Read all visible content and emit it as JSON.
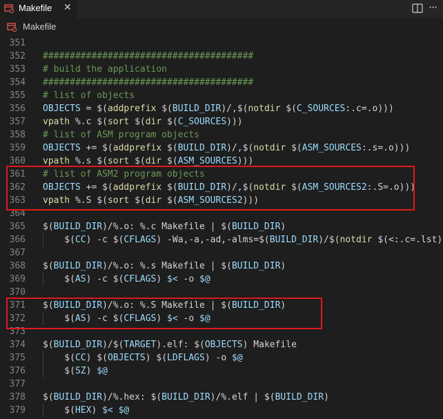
{
  "tab": {
    "label": "Makefile",
    "close": "✕"
  },
  "breadcrumb": {
    "label": "Makefile"
  },
  "header_actions": {
    "more": "···"
  },
  "colors": {
    "highlight": "#e0181c",
    "makefile_icon": "#e05050"
  },
  "lines": [
    {
      "n": "351",
      "code": []
    },
    {
      "n": "352",
      "code": [
        {
          "t": "#######################################",
          "c": "c-comment"
        }
      ]
    },
    {
      "n": "353",
      "code": [
        {
          "t": "# build the application",
          "c": "c-comment"
        }
      ]
    },
    {
      "n": "354",
      "code": [
        {
          "t": "#######################################",
          "c": "c-comment"
        }
      ]
    },
    {
      "n": "355",
      "code": [
        {
          "t": "# list of objects",
          "c": "c-comment"
        }
      ]
    },
    {
      "n": "356",
      "code": [
        {
          "t": "OBJECTS",
          "c": "c-var"
        },
        {
          "t": " = ",
          "c": "c-op"
        },
        {
          "t": "$(",
          "c": "c-op"
        },
        {
          "t": "addprefix",
          "c": "c-fn"
        },
        {
          "t": " ",
          "c": "c-op"
        },
        {
          "t": "$(",
          "c": "c-op"
        },
        {
          "t": "BUILD_DIR",
          "c": "c-var"
        },
        {
          "t": ")/,",
          "c": "c-op"
        },
        {
          "t": "$(",
          "c": "c-op"
        },
        {
          "t": "notdir",
          "c": "c-fn"
        },
        {
          "t": " ",
          "c": "c-op"
        },
        {
          "t": "$(",
          "c": "c-op"
        },
        {
          "t": "C_SOURCES",
          "c": "c-var"
        },
        {
          "t": ":.c=.o)))",
          "c": "c-op"
        }
      ]
    },
    {
      "n": "357",
      "code": [
        {
          "t": "vpath",
          "c": "c-fn"
        },
        {
          "t": " %.c ",
          "c": "c-op"
        },
        {
          "t": "$(",
          "c": "c-op"
        },
        {
          "t": "sort",
          "c": "c-fn"
        },
        {
          "t": " ",
          "c": "c-op"
        },
        {
          "t": "$(",
          "c": "c-op"
        },
        {
          "t": "dir",
          "c": "c-fn"
        },
        {
          "t": " ",
          "c": "c-op"
        },
        {
          "t": "$(",
          "c": "c-op"
        },
        {
          "t": "C_SOURCES",
          "c": "c-var"
        },
        {
          "t": ")))",
          "c": "c-op"
        }
      ]
    },
    {
      "n": "358",
      "code": [
        {
          "t": "# list of ASM program objects",
          "c": "c-comment"
        }
      ]
    },
    {
      "n": "359",
      "code": [
        {
          "t": "OBJECTS",
          "c": "c-var"
        },
        {
          "t": " += ",
          "c": "c-op"
        },
        {
          "t": "$(",
          "c": "c-op"
        },
        {
          "t": "addprefix",
          "c": "c-fn"
        },
        {
          "t": " ",
          "c": "c-op"
        },
        {
          "t": "$(",
          "c": "c-op"
        },
        {
          "t": "BUILD_DIR",
          "c": "c-var"
        },
        {
          "t": ")/,",
          "c": "c-op"
        },
        {
          "t": "$(",
          "c": "c-op"
        },
        {
          "t": "notdir",
          "c": "c-fn"
        },
        {
          "t": " ",
          "c": "c-op"
        },
        {
          "t": "$(",
          "c": "c-op"
        },
        {
          "t": "ASM_SOURCES",
          "c": "c-var"
        },
        {
          "t": ":.s=.o)))",
          "c": "c-op"
        }
      ]
    },
    {
      "n": "360",
      "code": [
        {
          "t": "vpath",
          "c": "c-fn"
        },
        {
          "t": " %.s ",
          "c": "c-op"
        },
        {
          "t": "$(",
          "c": "c-op"
        },
        {
          "t": "sort",
          "c": "c-fn"
        },
        {
          "t": " ",
          "c": "c-op"
        },
        {
          "t": "$(",
          "c": "c-op"
        },
        {
          "t": "dir",
          "c": "c-fn"
        },
        {
          "t": " ",
          "c": "c-op"
        },
        {
          "t": "$(",
          "c": "c-op"
        },
        {
          "t": "ASM_SOURCES",
          "c": "c-var"
        },
        {
          "t": ")))",
          "c": "c-op"
        }
      ]
    },
    {
      "n": "361",
      "code": [
        {
          "t": "# list of ASM2 program objects",
          "c": "c-comment"
        }
      ]
    },
    {
      "n": "362",
      "code": [
        {
          "t": "OBJECTS",
          "c": "c-var"
        },
        {
          "t": " += ",
          "c": "c-op"
        },
        {
          "t": "$(",
          "c": "c-op"
        },
        {
          "t": "addprefix",
          "c": "c-fn"
        },
        {
          "t": " ",
          "c": "c-op"
        },
        {
          "t": "$(",
          "c": "c-op"
        },
        {
          "t": "BUILD_DIR",
          "c": "c-var"
        },
        {
          "t": ")/,",
          "c": "c-op"
        },
        {
          "t": "$(",
          "c": "c-op"
        },
        {
          "t": "notdir",
          "c": "c-fn"
        },
        {
          "t": " ",
          "c": "c-op"
        },
        {
          "t": "$(",
          "c": "c-op"
        },
        {
          "t": "ASM_SOURCES2",
          "c": "c-var"
        },
        {
          "t": ":.S=.o)))",
          "c": "c-op"
        }
      ]
    },
    {
      "n": "363",
      "code": [
        {
          "t": "vpath",
          "c": "c-fn"
        },
        {
          "t": " %.S ",
          "c": "c-op"
        },
        {
          "t": "$(",
          "c": "c-op"
        },
        {
          "t": "sort",
          "c": "c-fn"
        },
        {
          "t": " ",
          "c": "c-op"
        },
        {
          "t": "$(",
          "c": "c-op"
        },
        {
          "t": "dir",
          "c": "c-fn"
        },
        {
          "t": " ",
          "c": "c-op"
        },
        {
          "t": "$(",
          "c": "c-op"
        },
        {
          "t": "ASM_SOURCES2",
          "c": "c-var"
        },
        {
          "t": ")))",
          "c": "c-op"
        }
      ]
    },
    {
      "n": "364",
      "code": []
    },
    {
      "n": "365",
      "code": [
        {
          "t": "$(",
          "c": "c-op"
        },
        {
          "t": "BUILD_DIR",
          "c": "c-var"
        },
        {
          "t": ")/%.o: %.c Makefile | ",
          "c": "c-op"
        },
        {
          "t": "$(",
          "c": "c-op"
        },
        {
          "t": "BUILD_DIR",
          "c": "c-var"
        },
        {
          "t": ")",
          "c": "c-op"
        }
      ]
    },
    {
      "n": "366",
      "indent": true,
      "code": [
        {
          "t": "    $(",
          "c": "c-op"
        },
        {
          "t": "CC",
          "c": "c-var"
        },
        {
          "t": ") -c ",
          "c": "c-op"
        },
        {
          "t": "$(",
          "c": "c-op"
        },
        {
          "t": "CFLAGS",
          "c": "c-var"
        },
        {
          "t": ") -Wa,-a,-ad,-alms=",
          "c": "c-op"
        },
        {
          "t": "$(",
          "c": "c-op"
        },
        {
          "t": "BUILD_DIR",
          "c": "c-var"
        },
        {
          "t": ")/",
          "c": "c-op"
        },
        {
          "t": "$(",
          "c": "c-op"
        },
        {
          "t": "notdir",
          "c": "c-fn"
        },
        {
          "t": " ",
          "c": "c-op"
        },
        {
          "t": "$(",
          "c": "c-op"
        },
        {
          "t": "<:.c=.lst)) ",
          "c": "c-op"
        }
      ]
    },
    {
      "n": "367",
      "code": []
    },
    {
      "n": "368",
      "code": [
        {
          "t": "$(",
          "c": "c-op"
        },
        {
          "t": "BUILD_DIR",
          "c": "c-var"
        },
        {
          "t": ")/%.o: %.s Makefile | ",
          "c": "c-op"
        },
        {
          "t": "$(",
          "c": "c-op"
        },
        {
          "t": "BUILD_DIR",
          "c": "c-var"
        },
        {
          "t": ")",
          "c": "c-op"
        }
      ]
    },
    {
      "n": "369",
      "indent": true,
      "code": [
        {
          "t": "    $(",
          "c": "c-op"
        },
        {
          "t": "AS",
          "c": "c-var"
        },
        {
          "t": ") -c ",
          "c": "c-op"
        },
        {
          "t": "$(",
          "c": "c-op"
        },
        {
          "t": "CFLAGS",
          "c": "c-var"
        },
        {
          "t": ") ",
          "c": "c-op"
        },
        {
          "t": "$<",
          "c": "c-var"
        },
        {
          "t": " -o ",
          "c": "c-op"
        },
        {
          "t": "$@",
          "c": "c-var"
        }
      ]
    },
    {
      "n": "370",
      "code": []
    },
    {
      "n": "371",
      "code": [
        {
          "t": "$(",
          "c": "c-op"
        },
        {
          "t": "BUILD_DIR",
          "c": "c-var"
        },
        {
          "t": ")/%.o: %.S Makefile | ",
          "c": "c-op"
        },
        {
          "t": "$(",
          "c": "c-op"
        },
        {
          "t": "BUILD_DIR",
          "c": "c-var"
        },
        {
          "t": ")",
          "c": "c-op"
        }
      ]
    },
    {
      "n": "372",
      "indent": true,
      "code": [
        {
          "t": "    $(",
          "c": "c-op"
        },
        {
          "t": "AS",
          "c": "c-var"
        },
        {
          "t": ") -c ",
          "c": "c-op"
        },
        {
          "t": "$(",
          "c": "c-op"
        },
        {
          "t": "CFLAGS",
          "c": "c-var"
        },
        {
          "t": ") ",
          "c": "c-op"
        },
        {
          "t": "$<",
          "c": "c-var"
        },
        {
          "t": " -o ",
          "c": "c-op"
        },
        {
          "t": "$@",
          "c": "c-var"
        }
      ]
    },
    {
      "n": "373",
      "code": []
    },
    {
      "n": "374",
      "code": [
        {
          "t": "$(",
          "c": "c-op"
        },
        {
          "t": "BUILD_DIR",
          "c": "c-var"
        },
        {
          "t": ")/",
          "c": "c-op"
        },
        {
          "t": "$(",
          "c": "c-op"
        },
        {
          "t": "TARGET",
          "c": "c-var"
        },
        {
          "t": ").elf: ",
          "c": "c-op"
        },
        {
          "t": "$(",
          "c": "c-op"
        },
        {
          "t": "OBJECTS",
          "c": "c-var"
        },
        {
          "t": ") Makefile",
          "c": "c-op"
        }
      ]
    },
    {
      "n": "375",
      "indent": true,
      "code": [
        {
          "t": "    $(",
          "c": "c-op"
        },
        {
          "t": "CC",
          "c": "c-var"
        },
        {
          "t": ") ",
          "c": "c-op"
        },
        {
          "t": "$(",
          "c": "c-op"
        },
        {
          "t": "OBJECTS",
          "c": "c-var"
        },
        {
          "t": ") ",
          "c": "c-op"
        },
        {
          "t": "$(",
          "c": "c-op"
        },
        {
          "t": "LDFLAGS",
          "c": "c-var"
        },
        {
          "t": ") -o ",
          "c": "c-op"
        },
        {
          "t": "$@",
          "c": "c-var"
        }
      ]
    },
    {
      "n": "376",
      "indent": true,
      "code": [
        {
          "t": "    $(",
          "c": "c-op"
        },
        {
          "t": "SZ",
          "c": "c-var"
        },
        {
          "t": ") ",
          "c": "c-op"
        },
        {
          "t": "$@",
          "c": "c-var"
        }
      ]
    },
    {
      "n": "377",
      "code": []
    },
    {
      "n": "378",
      "code": [
        {
          "t": "$(",
          "c": "c-op"
        },
        {
          "t": "BUILD_DIR",
          "c": "c-var"
        },
        {
          "t": ")/%.hex: ",
          "c": "c-op"
        },
        {
          "t": "$(",
          "c": "c-op"
        },
        {
          "t": "BUILD_DIR",
          "c": "c-var"
        },
        {
          "t": ")/%.elf | ",
          "c": "c-op"
        },
        {
          "t": "$(",
          "c": "c-op"
        },
        {
          "t": "BUILD_DIR",
          "c": "c-var"
        },
        {
          "t": ")",
          "c": "c-op"
        }
      ]
    },
    {
      "n": "379",
      "indent": true,
      "code": [
        {
          "t": "    $(",
          "c": "c-op"
        },
        {
          "t": "HEX",
          "c": "c-var"
        },
        {
          "t": ") ",
          "c": "c-op"
        },
        {
          "t": "$<",
          "c": "c-var"
        },
        {
          "t": " ",
          "c": "c-op"
        },
        {
          "t": "$@",
          "c": "c-var"
        }
      ]
    }
  ]
}
